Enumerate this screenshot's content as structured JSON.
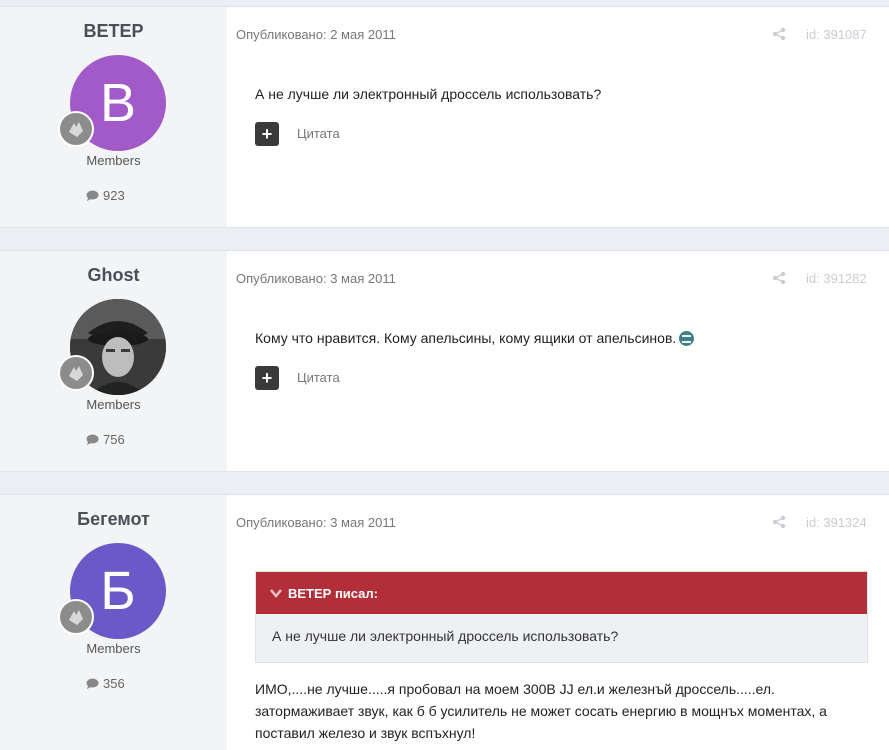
{
  "posts": [
    {
      "author": "ВЕТЕР",
      "avatar_letter": "B",
      "avatar_color": "#a35ac9",
      "group": "Members",
      "post_count": "923",
      "published": "Опубликовано: 2 мая 2011",
      "id": "id: 391087",
      "text": "А не лучше ли электронный дроссель использовать?",
      "quote_label": "Цитата"
    },
    {
      "author": "Ghost",
      "group": "Members",
      "post_count": "756",
      "published": "Опубликовано: 3 мая 2011",
      "id": "id: 391282",
      "text": "Кому что нравится. Кому апельсины, кому ящики от апельсинов.",
      "quote_label": "Цитата"
    },
    {
      "author": "Бегемот",
      "avatar_letter": "Б",
      "avatar_color": "#6b59c8",
      "group": "Members",
      "post_count": "356",
      "published": "Опубликовано: 3 мая 2011",
      "id": "id: 391324",
      "quote_header": "ВЕТЕР писал:",
      "quote_text": "А не лучше ли электронный дроссель использовать?",
      "text_lines": [
        "ИМО,....не лучше.....я пробовал на моем 300В JJ ел.и железнъй дроссель.....ел.",
        "затормаживает звук, как б б усилитель не может сосать енергию в мощнъх моментах, а",
        "поставил железо и звук вспъхнул!"
      ]
    }
  ],
  "colors": {
    "quote_header_bg": "#b22f3a",
    "page_bg": "#ebeef2"
  }
}
